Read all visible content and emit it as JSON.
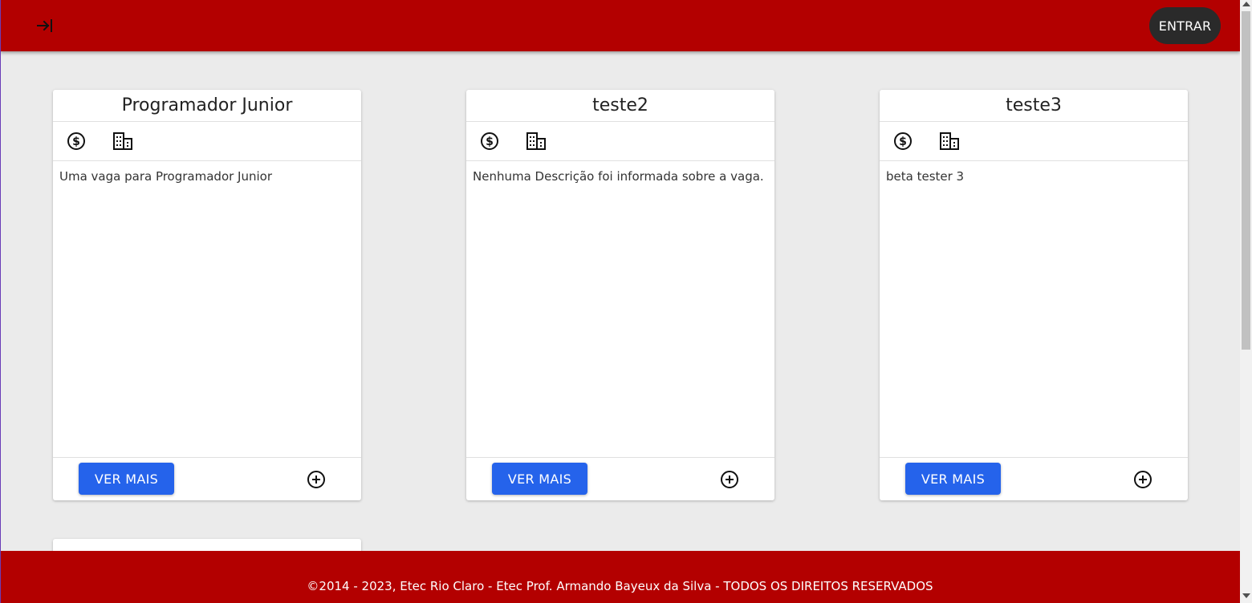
{
  "header": {
    "menu_icon": "arrow-right-to-bar-icon",
    "login_label": "ENTRAR"
  },
  "cards": [
    {
      "title": "Programador Junior",
      "description": "Uma vaga para Programador Junior",
      "more_label": "VER MAIS",
      "icons": [
        "salary-icon",
        "company-icon",
        "add-circle-icon"
      ]
    },
    {
      "title": "teste2",
      "description": "Nenhuma Descrição foi informada sobre a vaga.",
      "more_label": "VER MAIS",
      "icons": [
        "salary-icon",
        "company-icon",
        "add-circle-icon"
      ]
    },
    {
      "title": "teste3",
      "description": "beta tester 3",
      "more_label": "VER MAIS",
      "icons": [
        "salary-icon",
        "company-icon",
        "add-circle-icon"
      ]
    }
  ],
  "footer": {
    "copyright": "©2014 - 2023, Etec Rio Claro - Etec Prof. Armando Bayeux da Silva - TODOS OS DIREITOS RESERVADOS"
  },
  "colors": {
    "header_bg": "#b30000",
    "page_bg": "#ebebeb",
    "primary_button": "#2563eb",
    "login_button": "#2a2a2a"
  }
}
